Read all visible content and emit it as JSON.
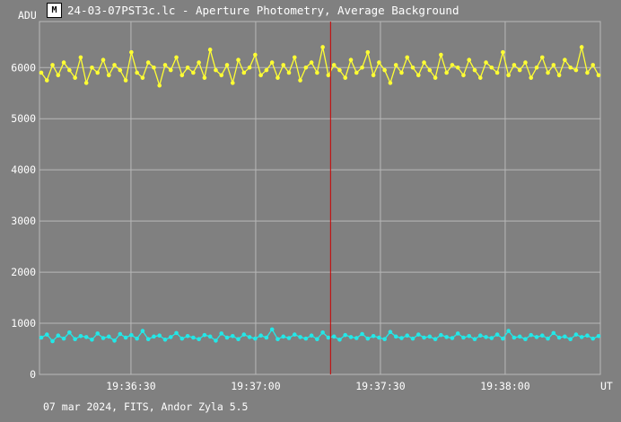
{
  "window": {
    "title": "24-03-07PST3c.lc - Aperture Photometry, Average Background",
    "icon": "app-logo-icon"
  },
  "footer": {
    "text": "07 mar 2024, FITS, Andor Zyla 5.5"
  },
  "colors": {
    "background": "#808080",
    "grid": "#b8b8b8",
    "series_a": "#ffff33",
    "series_b": "#22e8e8",
    "cursor": "#cc0000"
  },
  "chart_data": {
    "type": "line",
    "xlabel": "UT",
    "ylabel": "ADU",
    "ylim": [
      0,
      6900
    ],
    "xlim_seconds_from": "19:36:08",
    "x_ticks": [
      "19:36:30",
      "19:37:00",
      "19:37:30",
      "19:38:00"
    ],
    "y_ticks": [
      0,
      1000,
      2000,
      3000,
      4000,
      5000,
      6000
    ],
    "grid": true,
    "cursor_time": "19:37:18",
    "series": [
      {
        "mean": 5950,
        "spread": 230,
        "values": [
          5900,
          5750,
          6050,
          5850,
          6100,
          5950,
          5800,
          6200,
          5700,
          6000,
          5900,
          6150,
          5850,
          6050,
          5950,
          5750,
          6300,
          5900,
          5800,
          6100,
          6000,
          5650,
          6050,
          5950,
          6200,
          5850,
          6000,
          5900,
          6100,
          5800,
          6350,
          5950,
          5850,
          6050,
          5700,
          6150,
          5900,
          6000,
          6250,
          5850,
          5950,
          6100,
          5800,
          6050,
          5900,
          6200,
          5750,
          6000,
          6100,
          5900,
          6400,
          5850,
          6050,
          5950,
          5800,
          6150,
          5900,
          6000,
          6300,
          5850,
          6100,
          5950,
          5700,
          6050,
          5900,
          6200,
          6000,
          5850,
          6100,
          5950,
          5800,
          6250,
          5900,
          6050,
          6000,
          5850,
          6150,
          5950,
          5800,
          6100,
          6000,
          5900,
          6300,
          5850,
          6050,
          5950,
          6100,
          5800,
          6000,
          6200,
          5900,
          6050,
          5850,
          6150,
          6000,
          5950,
          6400,
          5900,
          6050,
          5850
        ]
      },
      {
        "mean": 730,
        "spread": 90,
        "values": [
          720,
          780,
          650,
          760,
          700,
          820,
          690,
          750,
          730,
          680,
          800,
          710,
          740,
          660,
          790,
          720,
          770,
          700,
          850,
          690,
          740,
          760,
          680,
          730,
          810,
          700,
          750,
          720,
          690,
          770,
          740,
          660,
          800,
          720,
          750,
          690,
          780,
          730,
          700,
          760,
          720,
          880,
          690,
          740,
          710,
          780,
          730,
          700,
          760,
          690,
          820,
          720,
          740,
          680,
          770,
          730,
          710,
          790,
          700,
          750,
          720,
          690,
          830,
          740,
          710,
          760,
          700,
          780,
          720,
          740,
          690,
          770,
          730,
          710,
          800,
          720,
          750,
          690,
          760,
          730,
          710,
          780,
          700,
          850,
          720,
          740,
          690,
          770,
          730,
          760,
          700,
          810,
          720,
          740,
          690,
          780,
          730,
          760,
          700,
          750
        ]
      }
    ]
  }
}
